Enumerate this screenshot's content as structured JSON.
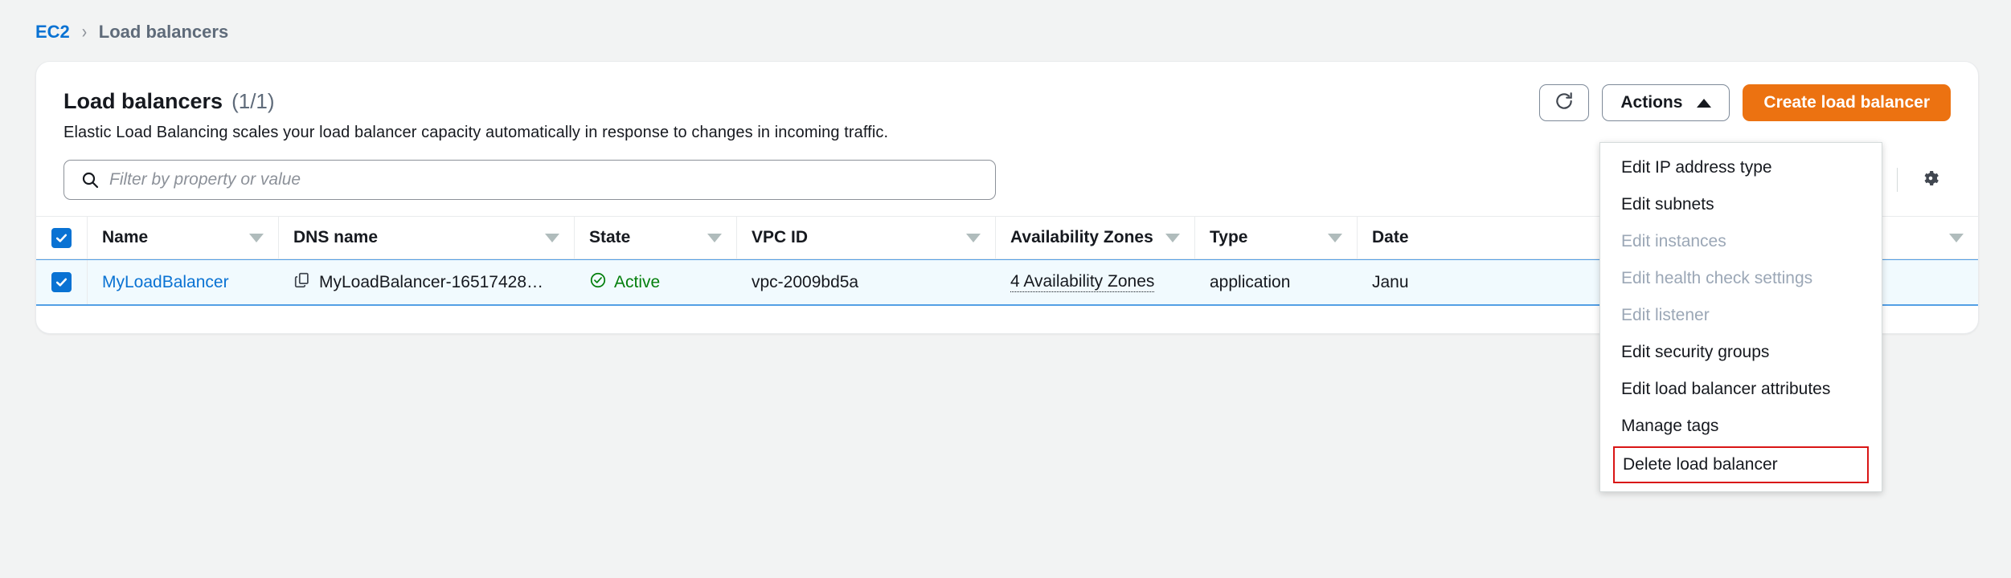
{
  "breadcrumb": {
    "root": "EC2",
    "separator": "›",
    "current": "Load balancers"
  },
  "panel": {
    "title": "Load balancers",
    "count": "(1/1)",
    "description": "Elastic Load Balancing scales your load balancer capacity automatically in response to changes in incoming traffic."
  },
  "toolbar": {
    "refresh_icon": "refresh-icon",
    "actions_label": "Actions",
    "actions_caret": "caret-up-icon",
    "create_label": "Create load balancer",
    "accent_orange": "#EC7211",
    "link_blue": "#0972D3"
  },
  "search": {
    "icon": "search-icon",
    "placeholder": "Filter by property or value",
    "value": ""
  },
  "pagination": {
    "next_icon": "chevron-right-icon",
    "settings_icon": "gear-icon"
  },
  "actions_menu": {
    "items": [
      {
        "label": "Edit IP address type",
        "disabled": false,
        "highlighted": false
      },
      {
        "label": "Edit subnets",
        "disabled": false,
        "highlighted": false
      },
      {
        "label": "Edit instances",
        "disabled": true,
        "highlighted": false
      },
      {
        "label": "Edit health check settings",
        "disabled": true,
        "highlighted": false
      },
      {
        "label": "Edit listener",
        "disabled": true,
        "highlighted": false
      },
      {
        "label": "Edit security groups",
        "disabled": false,
        "highlighted": false
      },
      {
        "label": "Edit load balancer attributes",
        "disabled": false,
        "highlighted": false
      },
      {
        "label": "Manage tags",
        "disabled": false,
        "highlighted": false
      },
      {
        "label": "Delete load balancer",
        "disabled": false,
        "highlighted": true
      }
    ],
    "highlight_color": "#D91515"
  },
  "table": {
    "select_all_checked": true,
    "columns": [
      {
        "label": "Name",
        "sortable": true
      },
      {
        "label": "DNS name",
        "sortable": true
      },
      {
        "label": "State",
        "sortable": true
      },
      {
        "label": "VPC ID",
        "sortable": true
      },
      {
        "label": "Availability Zones",
        "sortable": true
      },
      {
        "label": "Type",
        "sortable": true
      },
      {
        "label": "Date",
        "sortable": true
      }
    ],
    "rows": [
      {
        "selected": true,
        "name": "MyLoadBalancer",
        "dns_name": "MyLoadBalancer-16517428…",
        "dns_copy_icon": "copy-icon",
        "state": "Active",
        "state_icon": "status-success-icon",
        "state_color": "#037F0C",
        "vpc_id": "vpc-2009bd5a",
        "availability_zones": "4 Availability Zones",
        "type": "application",
        "date": "Janu"
      }
    ]
  }
}
